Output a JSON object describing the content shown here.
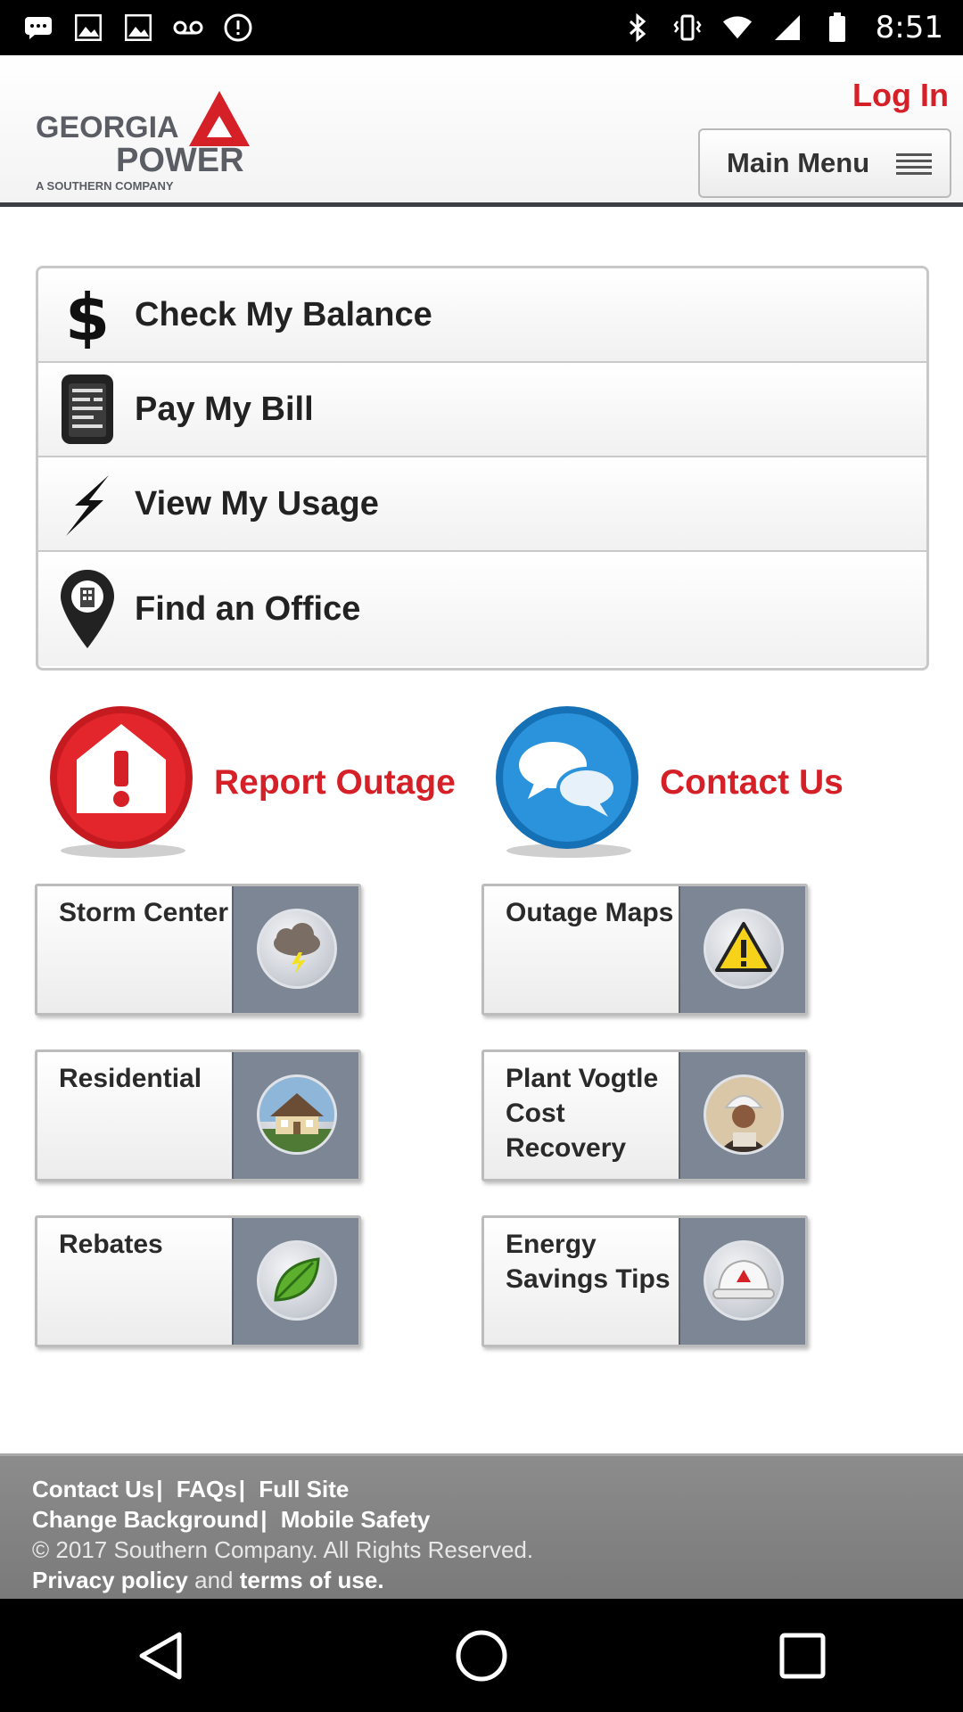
{
  "status_bar": {
    "time": "8:51",
    "left_icons": [
      "message-icon",
      "photo-icon",
      "photo-icon",
      "voicemail-icon",
      "info-icon"
    ],
    "right_icons": [
      "bluetooth-icon",
      "vibrate-icon",
      "wifi-icon",
      "signal-icon",
      "battery-icon"
    ]
  },
  "header": {
    "logo_brand": "GEORGIA POWER",
    "logo_tagline": "A SOUTHERN COMPANY",
    "login_label": "Log In",
    "main_menu_label": "Main Menu"
  },
  "menu": {
    "items": [
      {
        "label": "Check My Balance",
        "icon": "dollar-icon"
      },
      {
        "label": "Pay My Bill",
        "icon": "bill-icon"
      },
      {
        "label": "View My Usage",
        "icon": "lightning-icon"
      },
      {
        "label": "Find an Office",
        "icon": "map-pin-icon"
      }
    ]
  },
  "actions": {
    "report_outage": "Report Outage",
    "contact_us": "Contact Us"
  },
  "tiles": [
    {
      "label": "Storm Center",
      "icon": "storm-cloud-icon"
    },
    {
      "label": "Outage Maps",
      "icon": "warning-icon"
    },
    {
      "label": "Residential",
      "icon": "house-icon"
    },
    {
      "label": "Plant Vogtle Cost Recovery",
      "icon": "worker-icon"
    },
    {
      "label": "Rebates",
      "icon": "leaf-icon"
    },
    {
      "label": "Energy Savings Tips",
      "icon": "hardhat-icon"
    }
  ],
  "footer": {
    "links_row1": [
      "Contact Us",
      "FAQs",
      "Full Site"
    ],
    "links_row2": [
      "Change Background",
      "Mobile Safety"
    ],
    "copyright": "© 2017 Southern Company. All Rights Reserved.",
    "privacy": "Privacy policy",
    "and": "and",
    "terms": "terms of use."
  },
  "colors": {
    "brand_red": "#d62027",
    "contact_blue": "#1a86d0",
    "tile_panel": "#7d8694",
    "footer_bg": "#828282"
  }
}
